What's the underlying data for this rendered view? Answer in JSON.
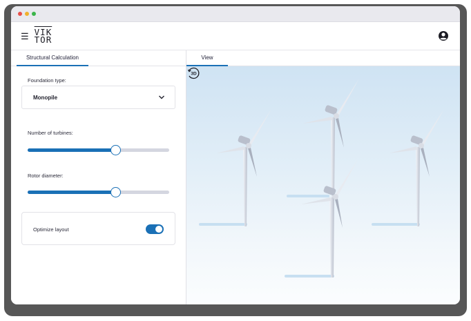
{
  "window": {
    "traffic_lights": [
      {
        "name": "close",
        "color": "#e8504a"
      },
      {
        "name": "minimize",
        "color": "#f0b12c"
      },
      {
        "name": "maximize",
        "color": "#3bb54a"
      }
    ]
  },
  "header": {
    "menu_icon": "hamburger-icon",
    "logo_top": "VIK",
    "logo_bottom": "TOR",
    "profile_icon": "user-circle-icon"
  },
  "left_panel": {
    "tab_label": "Structural Calculation",
    "foundation": {
      "label": "Foundation type:",
      "value": "Monopile",
      "icon": "chevron-down-icon"
    },
    "turbines": {
      "label": "Number of turbines:",
      "level": 0.62
    },
    "rotor": {
      "label": "Rotor diameter:",
      "level": 0.62
    },
    "optimize": {
      "label": "Optimize layout",
      "enabled": true
    }
  },
  "right_panel": {
    "tab_label": "View",
    "view_mode": "3D",
    "mode_icon": "rotate-3d-icon"
  },
  "colors": {
    "accent": "#1a70b6",
    "track": "#d4d6e0",
    "sky_top": "#cfe3f3"
  }
}
